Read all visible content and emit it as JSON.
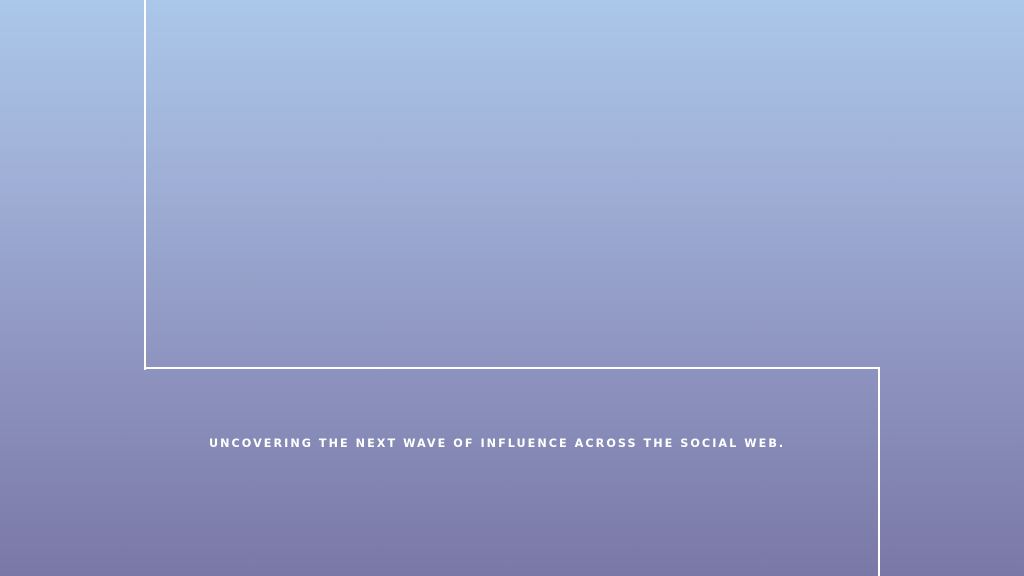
{
  "slide": {
    "tagline": "UNCOVERING THE NEXT WAVE OF INFLUENCE ACROSS THE SOCIAL WEB."
  },
  "colors": {
    "gradient_top": "#abc7ea",
    "gradient_bottom": "#7a78a6",
    "line": "#ffffff",
    "text": "#ffffff"
  }
}
